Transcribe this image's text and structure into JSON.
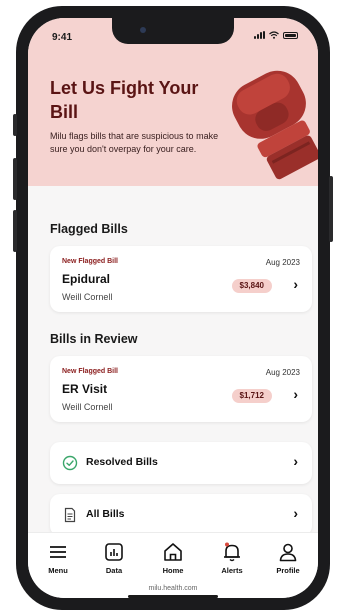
{
  "status_bar": {
    "time": "9:41"
  },
  "hero": {
    "title": "Let Us Fight Your Bill",
    "subtitle": "Milu flags bills that are suspicious to make sure you don't overpay for your care."
  },
  "sections": {
    "flagged": {
      "title": "Flagged Bills",
      "bill": {
        "badge": "New Flagged Bill",
        "date": "Aug 2023",
        "name": "Epidural",
        "provider": "Weill Cornell",
        "amount": "$3,840"
      }
    },
    "review": {
      "title": "Bills in Review",
      "bill": {
        "badge": "New Flagged Bill",
        "date": "Aug 2023",
        "name": "ER Visit",
        "provider": "Weill Cornell",
        "amount": "$1,712"
      }
    }
  },
  "rows": {
    "resolved": "Resolved Bills",
    "all": "All Bills"
  },
  "tabs": [
    {
      "label": "Menu",
      "icon": "menu-icon"
    },
    {
      "label": "Data",
      "icon": "chart-icon"
    },
    {
      "label": "Home",
      "icon": "home-icon"
    },
    {
      "label": "Alerts",
      "icon": "bell-icon"
    },
    {
      "label": "Profile",
      "icon": "user-icon"
    }
  ],
  "url": "milu.health.com",
  "colors": {
    "hero_bg": "#f5d3d0",
    "title": "#5a1414",
    "pill_bg": "#f5cfcb",
    "badge": "#8a1c1c",
    "resolved_icon": "#3aa66a"
  }
}
